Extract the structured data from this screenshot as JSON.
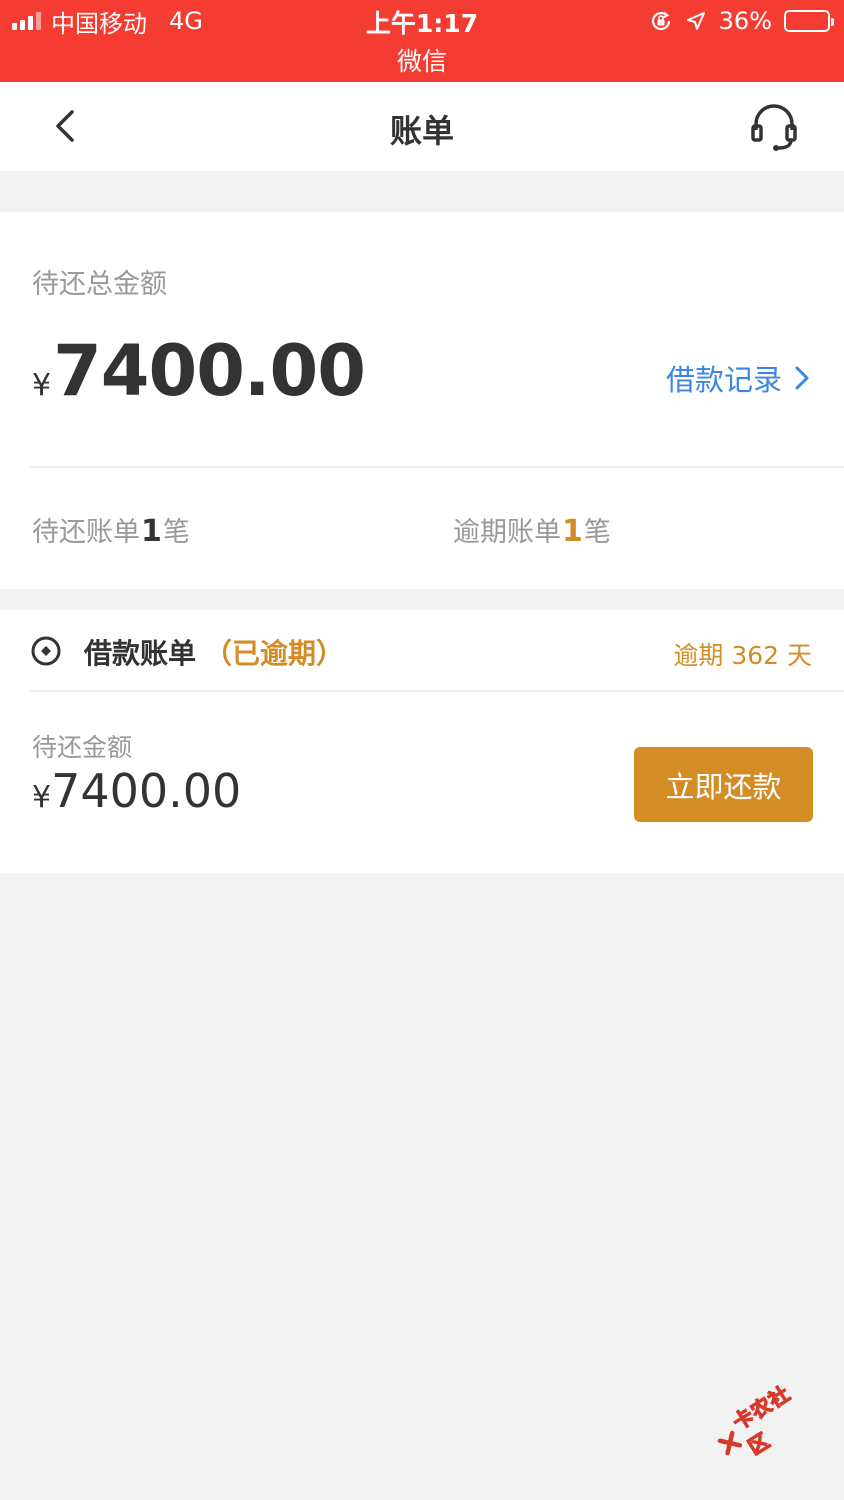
{
  "status_bar": {
    "carrier": "中国移动",
    "network": "4G",
    "time": "上午1:17",
    "app": "微信",
    "battery_percent": "36%",
    "battery_level": 0.36,
    "icons": [
      "signal-icon",
      "orientation-lock-icon",
      "location-icon",
      "battery-icon"
    ]
  },
  "nav": {
    "title": "账单",
    "back_icon": "chevron-left-icon",
    "service_icon": "headset-icon"
  },
  "summary": {
    "total_label": "待还总金额",
    "currency": "¥",
    "total_amount": "7400.00",
    "records_link": "借款记录",
    "pending": {
      "prefix": "待还账单",
      "count": "1",
      "suffix": "笔"
    },
    "overdue": {
      "prefix": "逾期账单",
      "count": "1",
      "suffix": "笔"
    }
  },
  "loan": {
    "title": "借款账单",
    "status": "（已逾期）",
    "overdue_text": "逾期 362 天",
    "amount_label": "待还金额",
    "currency": "¥",
    "amount": "7400.00",
    "pay_button": "立即还款"
  },
  "watermark": {
    "text": "卡农社区"
  },
  "colors": {
    "status_bar_bg": "#f43c33",
    "link_blue": "#3b86e5",
    "accent_gold": "#d48d25",
    "page_bg": "#f2f2f2"
  }
}
